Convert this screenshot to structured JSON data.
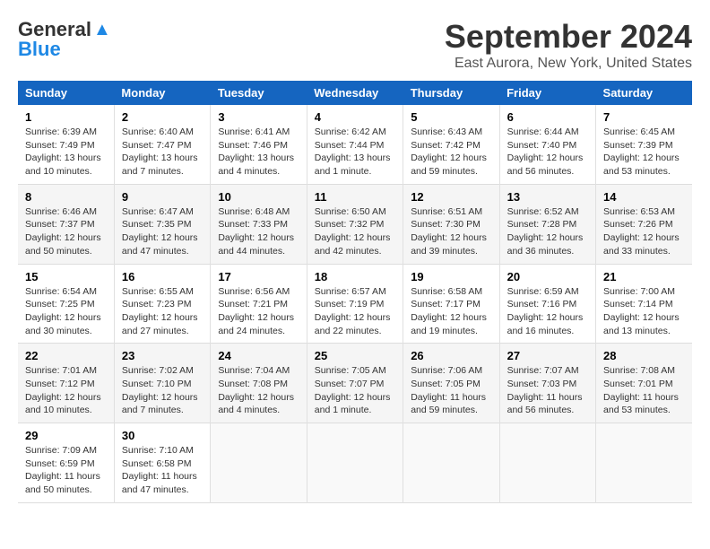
{
  "logo": {
    "line1": "General",
    "line2": "Blue"
  },
  "title": "September 2024",
  "subtitle": "East Aurora, New York, United States",
  "days_of_week": [
    "Sunday",
    "Monday",
    "Tuesday",
    "Wednesday",
    "Thursday",
    "Friday",
    "Saturday"
  ],
  "weeks": [
    [
      {
        "num": "1",
        "rise": "6:39 AM",
        "set": "7:49 PM",
        "daylight": "13 hours and 10 minutes."
      },
      {
        "num": "2",
        "rise": "6:40 AM",
        "set": "7:47 PM",
        "daylight": "13 hours and 7 minutes."
      },
      {
        "num": "3",
        "rise": "6:41 AM",
        "set": "7:46 PM",
        "daylight": "13 hours and 4 minutes."
      },
      {
        "num": "4",
        "rise": "6:42 AM",
        "set": "7:44 PM",
        "daylight": "13 hours and 1 minute."
      },
      {
        "num": "5",
        "rise": "6:43 AM",
        "set": "7:42 PM",
        "daylight": "12 hours and 59 minutes."
      },
      {
        "num": "6",
        "rise": "6:44 AM",
        "set": "7:40 PM",
        "daylight": "12 hours and 56 minutes."
      },
      {
        "num": "7",
        "rise": "6:45 AM",
        "set": "7:39 PM",
        "daylight": "12 hours and 53 minutes."
      }
    ],
    [
      {
        "num": "8",
        "rise": "6:46 AM",
        "set": "7:37 PM",
        "daylight": "12 hours and 50 minutes."
      },
      {
        "num": "9",
        "rise": "6:47 AM",
        "set": "7:35 PM",
        "daylight": "12 hours and 47 minutes."
      },
      {
        "num": "10",
        "rise": "6:48 AM",
        "set": "7:33 PM",
        "daylight": "12 hours and 44 minutes."
      },
      {
        "num": "11",
        "rise": "6:50 AM",
        "set": "7:32 PM",
        "daylight": "12 hours and 42 minutes."
      },
      {
        "num": "12",
        "rise": "6:51 AM",
        "set": "7:30 PM",
        "daylight": "12 hours and 39 minutes."
      },
      {
        "num": "13",
        "rise": "6:52 AM",
        "set": "7:28 PM",
        "daylight": "12 hours and 36 minutes."
      },
      {
        "num": "14",
        "rise": "6:53 AM",
        "set": "7:26 PM",
        "daylight": "12 hours and 33 minutes."
      }
    ],
    [
      {
        "num": "15",
        "rise": "6:54 AM",
        "set": "7:25 PM",
        "daylight": "12 hours and 30 minutes."
      },
      {
        "num": "16",
        "rise": "6:55 AM",
        "set": "7:23 PM",
        "daylight": "12 hours and 27 minutes."
      },
      {
        "num": "17",
        "rise": "6:56 AM",
        "set": "7:21 PM",
        "daylight": "12 hours and 24 minutes."
      },
      {
        "num": "18",
        "rise": "6:57 AM",
        "set": "7:19 PM",
        "daylight": "12 hours and 22 minutes."
      },
      {
        "num": "19",
        "rise": "6:58 AM",
        "set": "7:17 PM",
        "daylight": "12 hours and 19 minutes."
      },
      {
        "num": "20",
        "rise": "6:59 AM",
        "set": "7:16 PM",
        "daylight": "12 hours and 16 minutes."
      },
      {
        "num": "21",
        "rise": "7:00 AM",
        "set": "7:14 PM",
        "daylight": "12 hours and 13 minutes."
      }
    ],
    [
      {
        "num": "22",
        "rise": "7:01 AM",
        "set": "7:12 PM",
        "daylight": "12 hours and 10 minutes."
      },
      {
        "num": "23",
        "rise": "7:02 AM",
        "set": "7:10 PM",
        "daylight": "12 hours and 7 minutes."
      },
      {
        "num": "24",
        "rise": "7:04 AM",
        "set": "7:08 PM",
        "daylight": "12 hours and 4 minutes."
      },
      {
        "num": "25",
        "rise": "7:05 AM",
        "set": "7:07 PM",
        "daylight": "12 hours and 1 minute."
      },
      {
        "num": "26",
        "rise": "7:06 AM",
        "set": "7:05 PM",
        "daylight": "11 hours and 59 minutes."
      },
      {
        "num": "27",
        "rise": "7:07 AM",
        "set": "7:03 PM",
        "daylight": "11 hours and 56 minutes."
      },
      {
        "num": "28",
        "rise": "7:08 AM",
        "set": "7:01 PM",
        "daylight": "11 hours and 53 minutes."
      }
    ],
    [
      {
        "num": "29",
        "rise": "7:09 AM",
        "set": "6:59 PM",
        "daylight": "11 hours and 50 minutes."
      },
      {
        "num": "30",
        "rise": "7:10 AM",
        "set": "6:58 PM",
        "daylight": "11 hours and 47 minutes."
      },
      null,
      null,
      null,
      null,
      null
    ]
  ]
}
